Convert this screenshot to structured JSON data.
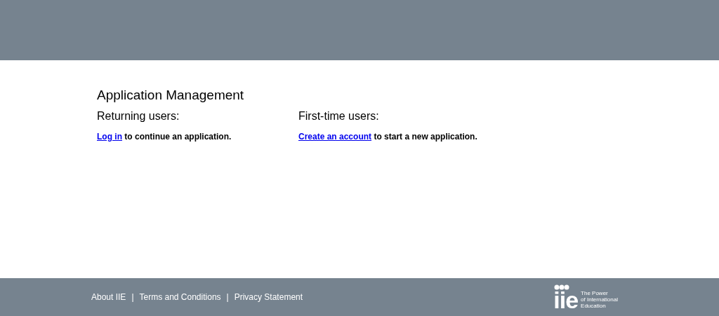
{
  "title": "Application Management",
  "sections": [
    {
      "heading": "Returning users:",
      "link": "Log in",
      "text": " to continue an application."
    },
    {
      "heading": "First-time users:",
      "link": "Create an account",
      "text": " to start a new application."
    }
  ],
  "footer": {
    "links": [
      "About IIE",
      "Terms and Conditions",
      "Privacy Statement"
    ],
    "separator": "|",
    "logo": {
      "mark": "iie",
      "tagline": [
        "The Power",
        "of International",
        "Education"
      ]
    }
  }
}
